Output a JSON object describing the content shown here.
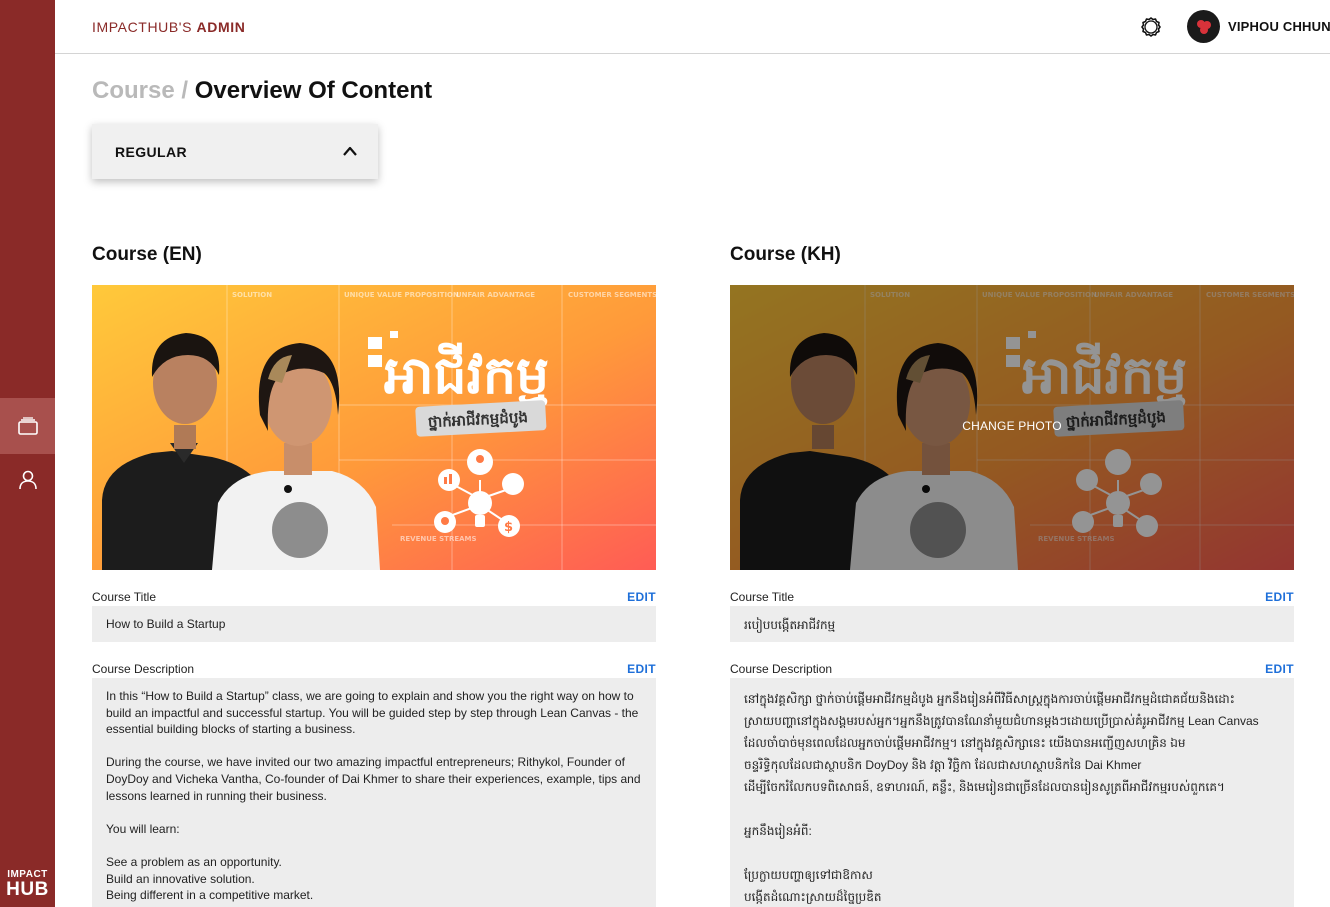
{
  "app": {
    "brand_prefix": "IMPACTHUB'S",
    "brand_suffix": "ADMIN",
    "user_name": "VIPHOU CHHUN",
    "logo_line1": "IMPACT",
    "logo_line2": "HUB"
  },
  "sidebar": {
    "items": [
      {
        "icon": "layers-icon",
        "active": true
      },
      {
        "icon": "user-icon",
        "active": false
      }
    ]
  },
  "breadcrumb": {
    "parent": "Course /",
    "current": "Overview Of Content"
  },
  "level_select": {
    "value": "REGULAR"
  },
  "courses": {
    "en": {
      "heading": "Course (EN)",
      "image_banner_kh": "អាជីវកម្ម",
      "image_subbanner_kh": "ថ្នាក់អាជីវកម្មដំបូង",
      "image_grid_labels": [
        "SOLUTION",
        "UNIQUE VALUE PROPOSITION",
        "UNFAIR ADVANTAGE",
        "CUSTOMER SEGMENTS",
        "REVENUE STREAMS"
      ],
      "title_label": "Course Title",
      "title_edit": "EDIT",
      "title_value": "How to Build a Startup",
      "desc_label": "Course Description",
      "desc_edit": "EDIT",
      "desc_paragraphs": [
        "In this “How to Build a Startup” class, we are going to explain and show you the right way on how to build an impactful and successful startup. You will be guided step by step through Lean Canvas - the essential building blocks of starting a business.",
        "During the course, we have invited our two amazing impactful entrepreneurs; Rithykol, Founder of DoyDoy and Vicheka Vantha, Co-founder of Dai Khmer to share their experiences, example, tips and lessons learned in running their business.",
        "You will learn:"
      ],
      "desc_list": [
        "See a problem as an opportunity.",
        "Build an innovative solution.",
        "Being different in a competitive market."
      ]
    },
    "kh": {
      "heading": "Course (KH)",
      "change_photo": "CHANGE PHOTO",
      "title_label": "Course Title",
      "title_edit": "EDIT",
      "title_value": "របៀបបង្កើតអាជីវកម្ម",
      "desc_label": "Course Description",
      "desc_edit": "EDIT",
      "desc_lines": [
        "នៅក្នុងវគ្គសិក្សា ថ្នាក់ចាប់ផ្តើមអាជីវកម្មដំបូង អ្នកនឹងរៀនអំពីវិធីសាស្រ្តក្នុងការចាប់ផ្តើមអាជីវកម្មដំជោគជ័យនិងដោះ",
        "ស្រាយបញ្ហានៅក្នុងសង្គមរបស់អ្នក។អ្នកនឹងត្រូវបានណែនាំមួយជំហានម្តងៗដោយប្រើប្រាស់គំរូអាជីវកម្ម Lean Canvas",
        "ដែលចាំបាច់មុនពេលដែលអ្នកចាប់ផ្តើមអាជីវកម្ម។ នៅក្នុងវគ្គសិក្សានេះ យើងបានអញ្ជើញសហគ្រិន ឯម",
        "ចន្ទរិទ្ធិកុលដែលជាស្ថាបនិក DoyDoy និង វត្តា វិច្ឆិកា ដែលជាសហស្ថាបនិកនៃ Dai Khmer",
        "ដើម្បីចែករំលែកបទពិសោធន៍, ឧទាហរណ៍, គន្លឹះ, និងមេរៀនជាច្រើនដែលបានរៀនសូត្រពីអាជីវកម្មរបស់ពួកគេ។"
      ],
      "desc_learn": "អ្នកនឹងរៀនអំពី:",
      "desc_list": [
        "ប្រែក្លាយបញ្ហាឲ្យទៅជាឱកាស",
        "បង្កើតដំណោះស្រាយដ៏ច្នៃប្រឌិត"
      ]
    }
  }
}
